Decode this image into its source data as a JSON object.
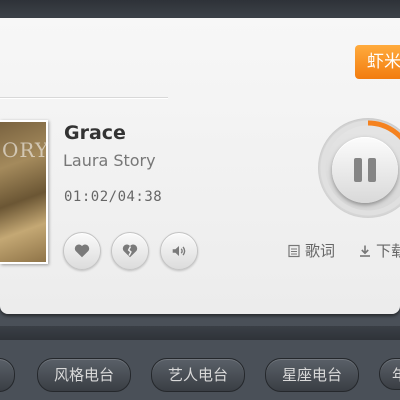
{
  "player": {
    "brand_label": "虾米",
    "cover_text": "ORY",
    "song_title": "Grace",
    "artist": "Laura Story",
    "time_display": "01:02/04:38",
    "progress_fraction": 0.22,
    "lyrics_label": "歌词",
    "download_label": "下载"
  },
  "controls": {
    "icons": [
      "heart-icon",
      "broken-heart-icon",
      "volume-icon",
      "pause-icon"
    ]
  },
  "tabs": [
    {
      "label": ""
    },
    {
      "label": "风格电台"
    },
    {
      "label": "艺人电台"
    },
    {
      "label": "星座电台"
    },
    {
      "label": "年"
    }
  ],
  "colors": {
    "accent": "#f27c0f",
    "progress": "#f5821f"
  }
}
